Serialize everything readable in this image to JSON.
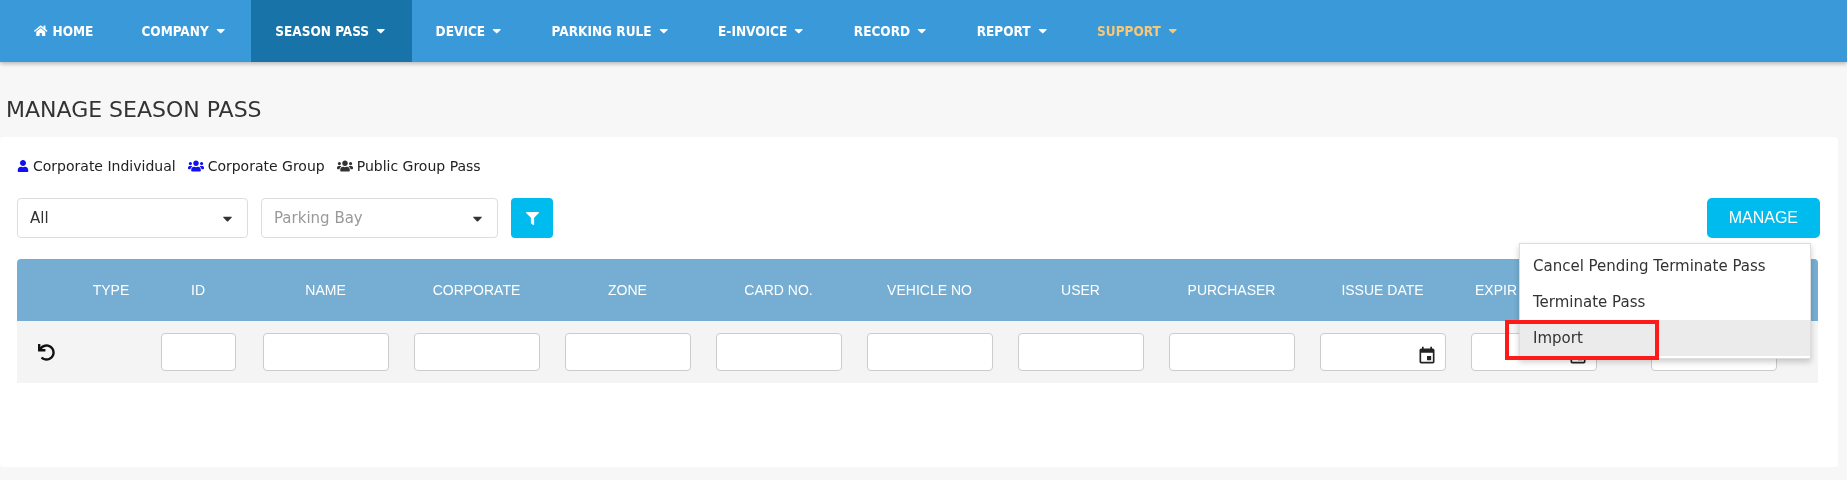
{
  "nav": {
    "items": [
      {
        "label": "HOME",
        "kind": "home",
        "caret": false,
        "selected": false,
        "color": "#ffffff"
      },
      {
        "label": "COMPANY",
        "kind": "menu",
        "caret": true,
        "selected": false,
        "color": "#ffffff"
      },
      {
        "label": "SEASON PASS",
        "kind": "menu",
        "caret": true,
        "selected": true,
        "color": "#ffffff"
      },
      {
        "label": "DEVICE",
        "kind": "menu",
        "caret": true,
        "selected": false,
        "color": "#ffffff"
      },
      {
        "label": "PARKING RULE",
        "kind": "menu",
        "caret": true,
        "selected": false,
        "color": "#ffffff"
      },
      {
        "label": "E-INVOICE",
        "kind": "menu",
        "caret": true,
        "selected": false,
        "color": "#ffffff"
      },
      {
        "label": "RECORD",
        "kind": "menu",
        "caret": true,
        "selected": false,
        "color": "#ffffff"
      },
      {
        "label": "REPORT",
        "kind": "menu",
        "caret": true,
        "selected": false,
        "color": "#ffffff"
      },
      {
        "label": "SUPPORT",
        "kind": "menu",
        "caret": true,
        "selected": false,
        "color": "#f5c87a"
      }
    ]
  },
  "page_title": "MANAGE SEASON PASS",
  "legend": [
    {
      "label": "Corporate Individual",
      "kind": "single",
      "color": "#1010f0"
    },
    {
      "label": "Corporate Group",
      "kind": "group",
      "color": "#1010f0"
    },
    {
      "label": "Public Group Pass",
      "kind": "group",
      "color": "#333333"
    }
  ],
  "filters": {
    "type_select": {
      "value": "All"
    },
    "bay_select": {
      "placeholder": "Parking Bay"
    }
  },
  "manage_button": {
    "label": "MANAGE"
  },
  "manage_menu": {
    "items": [
      {
        "label": "Cancel Pending Terminate Pass",
        "hovered": false,
        "marked": false
      },
      {
        "label": "Terminate Pass",
        "hovered": false,
        "marked": false
      },
      {
        "label": "Import",
        "hovered": true,
        "marked": true
      }
    ]
  },
  "table": {
    "columns": [
      "TYPE",
      "ID",
      "NAME",
      "CORPORATE",
      "ZONE",
      "CARD NO.",
      "VEHICLE NO",
      "USER",
      "PURCHASER",
      "ISSUE DATE",
      "EXPIR"
    ],
    "filter_row": [
      {
        "kind": "none"
      },
      {
        "kind": "text"
      },
      {
        "kind": "text"
      },
      {
        "kind": "text"
      },
      {
        "kind": "text"
      },
      {
        "kind": "text"
      },
      {
        "kind": "text"
      },
      {
        "kind": "text"
      },
      {
        "kind": "text"
      },
      {
        "kind": "date"
      },
      {
        "kind": "date"
      },
      {
        "kind": "text"
      }
    ]
  }
}
